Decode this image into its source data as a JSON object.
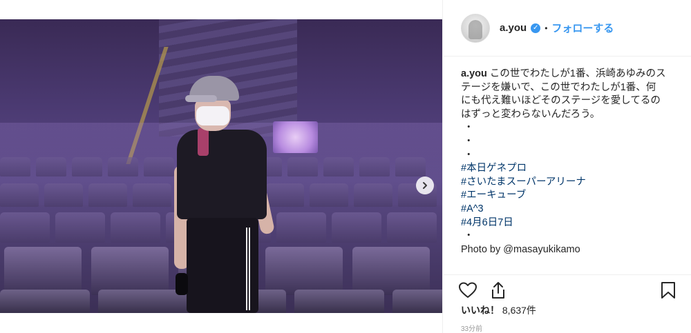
{
  "post": {
    "slide_count": 3,
    "active_slide": 1
  },
  "header": {
    "username": "a.you",
    "verified_glyph": "✓",
    "separator": "•",
    "follow_label": "フォローする"
  },
  "caption": {
    "author": "a.you",
    "lines": [
      "この世でわたしが1番、浜崎あゆみのス",
      "テージを嫌いで、この世でわたしが1番、何",
      "にも代え難いほどそのステージを愛してるの",
      "はずっと変わらないんだろう。",
      "・",
      "・",
      "・"
    ],
    "hashtags": [
      "#本日ゲネプロ",
      "#さいたまスーパーアリーナ",
      "#エーキューブ",
      "#A^3",
      "#4月6日7日"
    ],
    "after_tags": "・",
    "photo_credit_prefix": "Photo by ",
    "photo_credit_handle": "@masayukikamo"
  },
  "actions": {
    "like_icon": "heart-icon",
    "share_icon": "share-icon",
    "save_icon": "bookmark-icon"
  },
  "likes": {
    "label": "いいね！",
    "count": "8,637件"
  },
  "timestamp": "33分前",
  "colors": {
    "accent": "#3897f0",
    "hashtag": "#003569",
    "text": "#262626",
    "muted": "#999999"
  }
}
